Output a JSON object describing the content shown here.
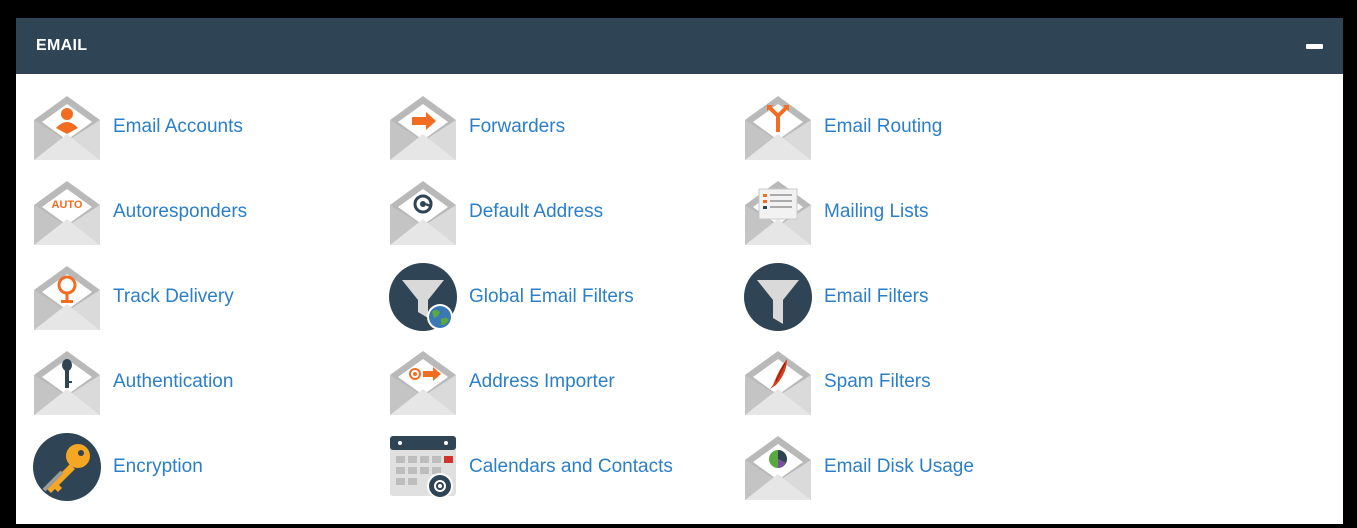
{
  "panel": {
    "title": "EMAIL",
    "collapse_icon": "minus-icon"
  },
  "items": [
    {
      "label": "Email Accounts",
      "icon": "email-accounts-icon"
    },
    {
      "label": "Forwarders",
      "icon": "forwarders-icon"
    },
    {
      "label": "Email Routing",
      "icon": "email-routing-icon"
    },
    {
      "label": "Autoresponders",
      "icon": "autoresponders-icon",
      "icon_text": "AUTO"
    },
    {
      "label": "Default Address",
      "icon": "default-address-icon"
    },
    {
      "label": "Mailing Lists",
      "icon": "mailing-lists-icon"
    },
    {
      "label": "Track Delivery",
      "icon": "track-delivery-icon"
    },
    {
      "label": "Global Email Filters",
      "icon": "global-email-filters-icon"
    },
    {
      "label": "Email Filters",
      "icon": "email-filters-icon"
    },
    {
      "label": "Authentication",
      "icon": "authentication-icon"
    },
    {
      "label": "Address Importer",
      "icon": "address-importer-icon"
    },
    {
      "label": "Spam Filters",
      "icon": "spam-filters-icon"
    },
    {
      "label": "Encryption",
      "icon": "encryption-icon"
    },
    {
      "label": "Calendars and Contacts",
      "icon": "calendars-and-contacts-icon"
    },
    {
      "label": "Email Disk Usage",
      "icon": "email-disk-usage-icon"
    }
  ],
  "colors": {
    "header_bg": "#2f4454",
    "link": "#2b7fc9",
    "icon_orange": "#f26d21",
    "envelope_gray": "#cfcfcf",
    "dark_circle": "#2f4454"
  }
}
